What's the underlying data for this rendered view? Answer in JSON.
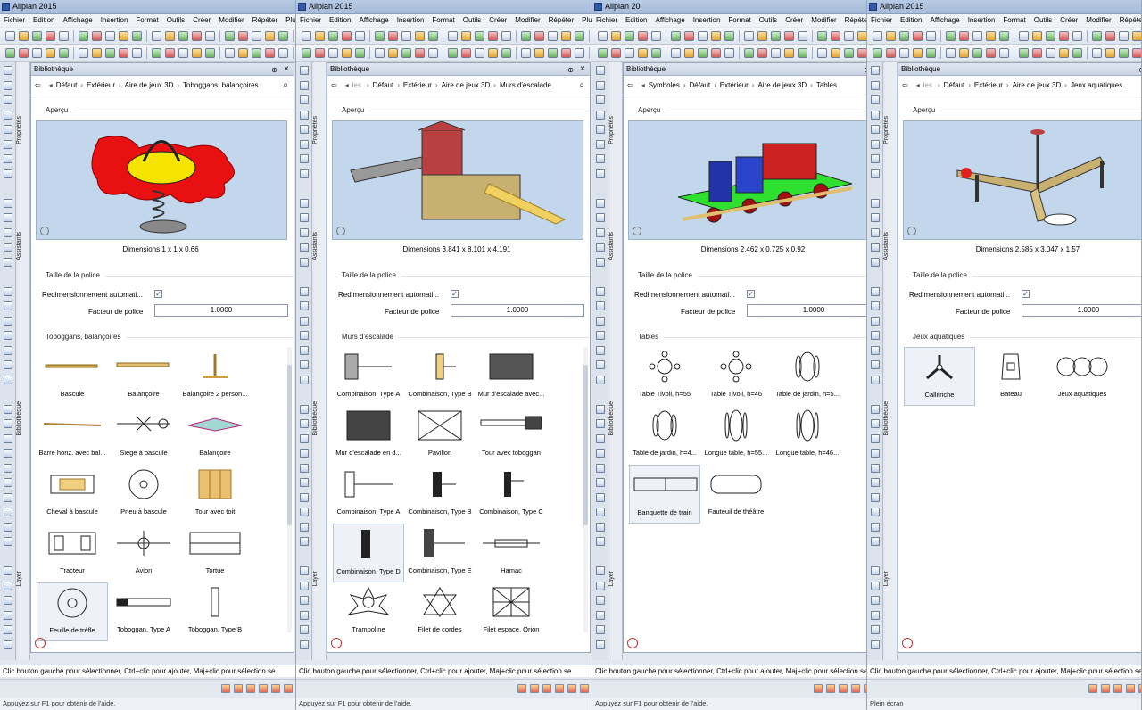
{
  "menu": [
    "Fichier",
    "Edition",
    "Affichage",
    "Insertion",
    "Format",
    "Outils",
    "Créer",
    "Modifier",
    "Répéter",
    "Plug"
  ],
  "status_select": "Clic bouton gauche pour sélectionner, Ctrl+clic pour ajouter, Maj+clic pour sélection se",
  "help_text": "Appuyez sur F1 pour obtenir de l'aide.",
  "full_screen": "Plein écran",
  "side_labels": {
    "props": "Propriétés",
    "assist": "Assistants",
    "biblio": "Bibliothèque",
    "layer": "Layer"
  },
  "lib_title": "Bibliothèque",
  "apercu": "Aperçu",
  "font_section": "Taille de la police",
  "auto_resize": "Redimensionnement automati...",
  "font_factor_label": "Facteur de police",
  "font_factor": "1.0000",
  "panels": [
    {
      "app_title": "Allplan 2015",
      "crumbs": [
        "Défaut",
        "Extérieur",
        "Aire de jeux 3D",
        "Toboggans, balançoires"
      ],
      "crumb_lead": "",
      "dimensions": "Dimensions     1 x 1 x 0,66",
      "category": "Toboggans, balançoires",
      "items": [
        "Bascule",
        "Balançoire",
        "Balançoire 2 person...",
        "Barre horiz. avec bal...",
        "Siège à bascule",
        "Balançoire",
        "Cheval à bascule",
        "Pneu à bascule",
        "Tour avec toit",
        "Tracteur",
        "Avion",
        "Tortue",
        "Feuille de trèfle",
        "Toboggan, Type A",
        "Toboggan, Type B"
      ]
    },
    {
      "app_title": "Allplan 2015",
      "crumbs": [
        "Défaut",
        "Extérieur",
        "Aire de jeux 3D",
        "Murs d'escalade"
      ],
      "crumb_lead": "les",
      "dimensions": "Dimensions     3,841 x 8,101 x 4,191",
      "category": "Murs d'escalade",
      "items": [
        "Combinaison, Type A",
        "Combinaison, Type B",
        "Mur d'escalade avec...",
        "Mur d'escalade en d...",
        "Pavillon",
        "Tour avec toboggan",
        "Combinaison, Type A",
        "Combinaison, Type B",
        "Combinaison, Type C",
        "Combinaison, Type D",
        "Combinaison, Type E",
        "Hamac",
        "Trampoline",
        "Filet de cordes",
        "Filet espace, Orion"
      ]
    },
    {
      "app_title": "Allplan 20",
      "crumbs": [
        "Symboles",
        "Défaut",
        "Extérieur",
        "Aire de jeux 3D",
        "Tables"
      ],
      "crumb_lead": "",
      "dimensions": "Dimensions     2,462 x 0,725 x 0,92",
      "category": "Tables",
      "items": [
        "Table Tivoli, h=55",
        "Table Tivoli, h=46",
        "Table de jardin, h=5...",
        "Table de jardin, h=4...",
        "Longue table, h=55...",
        "Longue table, h=46...",
        "Banquette de train",
        "Fauteuil de théâtre"
      ]
    },
    {
      "app_title": "Allplan 2015",
      "crumbs": [
        "Défaut",
        "Extérieur",
        "Aire de jeux 3D",
        "Jeux aquatiques"
      ],
      "crumb_lead": "les",
      "dimensions": "Dimensions     2,585 x 3,047 x 1,57",
      "category": "Jeux aquatiques",
      "items": [
        "Callitriche",
        "Bateau",
        "Jeux aquatiques"
      ]
    }
  ]
}
